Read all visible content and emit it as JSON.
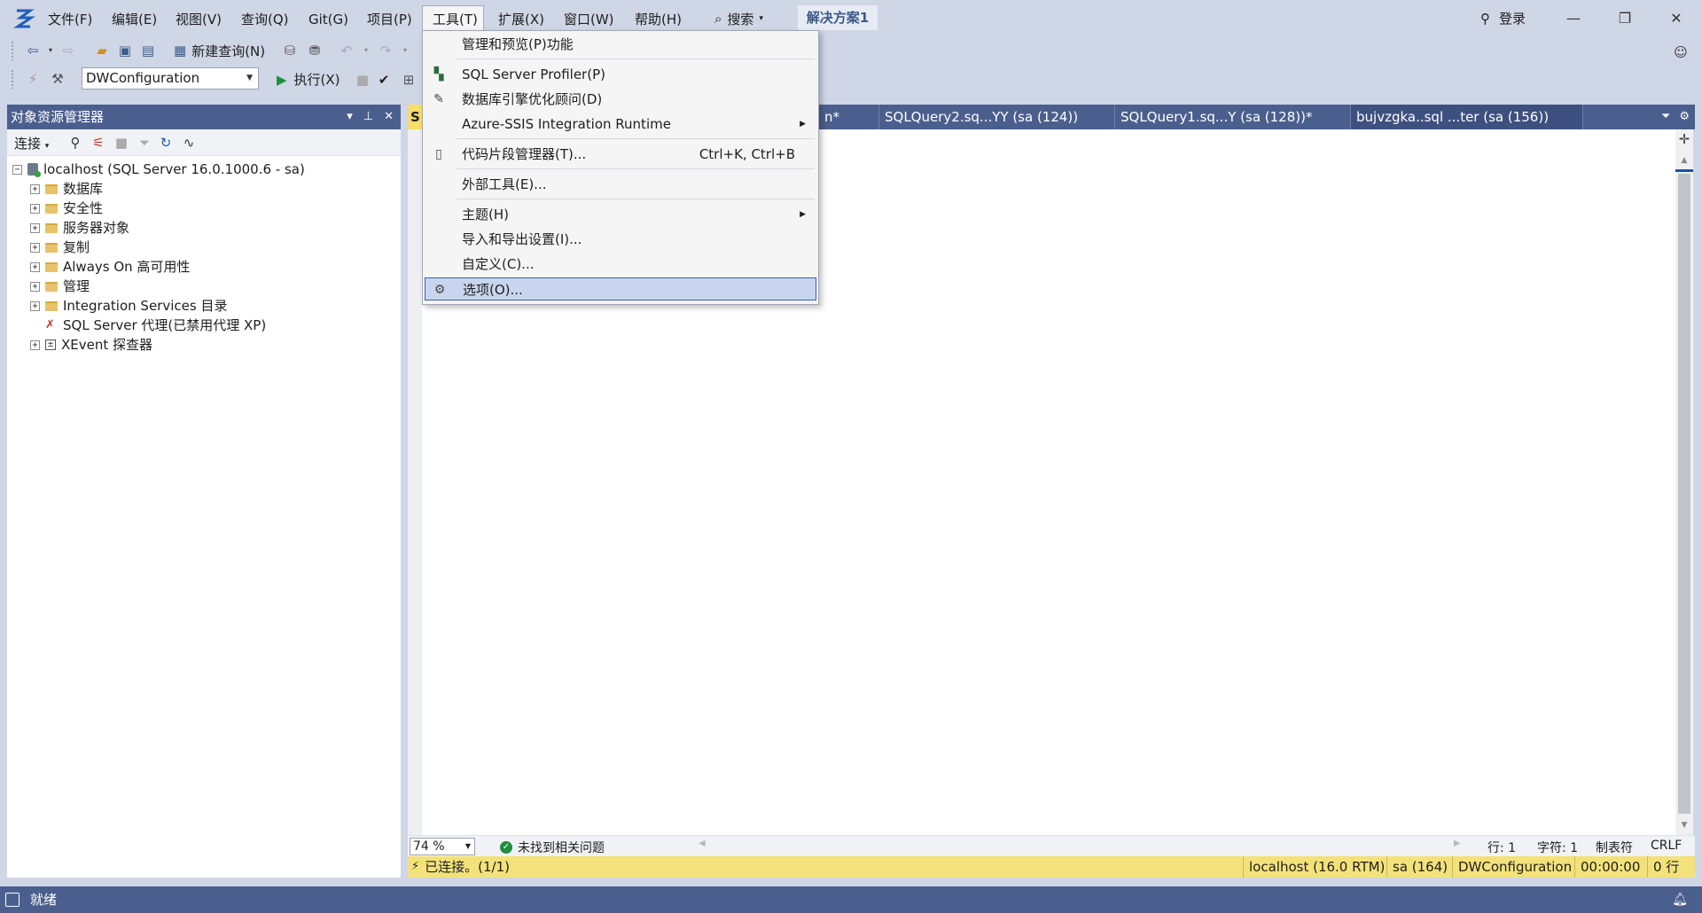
{
  "menu": {
    "file": "文件(F)",
    "edit": "编辑(E)",
    "view": "视图(V)",
    "query": "查询(Q)",
    "git": "Git(G)",
    "project": "项目(P)",
    "tools": "工具(T)",
    "extensions": "扩展(X)",
    "window": "窗口(W)",
    "help": "帮助(H)"
  },
  "search": {
    "label": "搜索"
  },
  "solution": {
    "name": "解决方案1"
  },
  "account": {
    "login": "登录"
  },
  "toolbar": {
    "new_query": "新建查询(N)",
    "database": "DWConfiguration",
    "execute": "执行(X)"
  },
  "object_explorer": {
    "title": "对象资源管理器",
    "connect": "连接",
    "server": "localhost (SQL Server 16.0.1000.6 - sa)",
    "items": [
      {
        "label": "数据库",
        "icon": "folder-icon"
      },
      {
        "label": "安全性",
        "icon": "folder-icon"
      },
      {
        "label": "服务器对象",
        "icon": "folder-icon"
      },
      {
        "label": "复制",
        "icon": "folder-icon"
      },
      {
        "label": "Always On 高可用性",
        "icon": "folder-icon"
      },
      {
        "label": "管理",
        "icon": "folder-icon"
      },
      {
        "label": "Integration Services 目录",
        "icon": "folder-icon"
      },
      {
        "label": "SQL Server 代理(已禁用代理 XP)",
        "icon": "agent-icon"
      },
      {
        "label": "XEvent 探查器",
        "icon": "xevent-icon"
      }
    ]
  },
  "tabs": {
    "active_fragment": "S",
    "partial": "n*",
    "items": [
      "SQLQuery2.sq...YY (sa (124))",
      "SQLQuery1.sq...Y (sa (128))*",
      "bujvzgka..sql ...ter (sa (156))"
    ]
  },
  "tools_menu": {
    "items": [
      {
        "label": "管理和预览(P)功能"
      },
      {
        "label": "SQL Server Profiler(P)",
        "icon": "profiler-icon"
      },
      {
        "label": "数据库引擎优化顾问(D)",
        "icon": "tuning-advisor-icon"
      },
      {
        "label": "Azure-SSIS Integration Runtime",
        "submenu": true
      },
      {
        "label": "代码片段管理器(T)...",
        "shortcut": "Ctrl+K, Ctrl+B",
        "icon": "snippet-icon"
      },
      {
        "label": "外部工具(E)..."
      },
      {
        "label": "主题(H)",
        "submenu": true
      },
      {
        "label": "导入和导出设置(I)..."
      },
      {
        "label": "自定义(C)..."
      },
      {
        "label": "选项(O)...",
        "icon": "gear-icon",
        "highlighted": true
      }
    ]
  },
  "editor_status": {
    "zoom": "74 %",
    "issues": "未找到相关问题",
    "line": "行: 1",
    "char": "字符: 1",
    "tab_mode": "制表符",
    "eol": "CRLF"
  },
  "query_status": {
    "connected": "已连接。(1/1)",
    "server": "localhost (16.0 RTM)",
    "user": "sa (164)",
    "database": "DWConfiguration",
    "elapsed": "00:00:00",
    "rows": "0 行"
  },
  "app_status": {
    "text": "就绪"
  },
  "colors": {
    "chrome": "#cfd6e5",
    "panel_header": "#4b5f8f",
    "query_status": "#f3e27a",
    "menu_highlight": "#c9d5ee"
  }
}
